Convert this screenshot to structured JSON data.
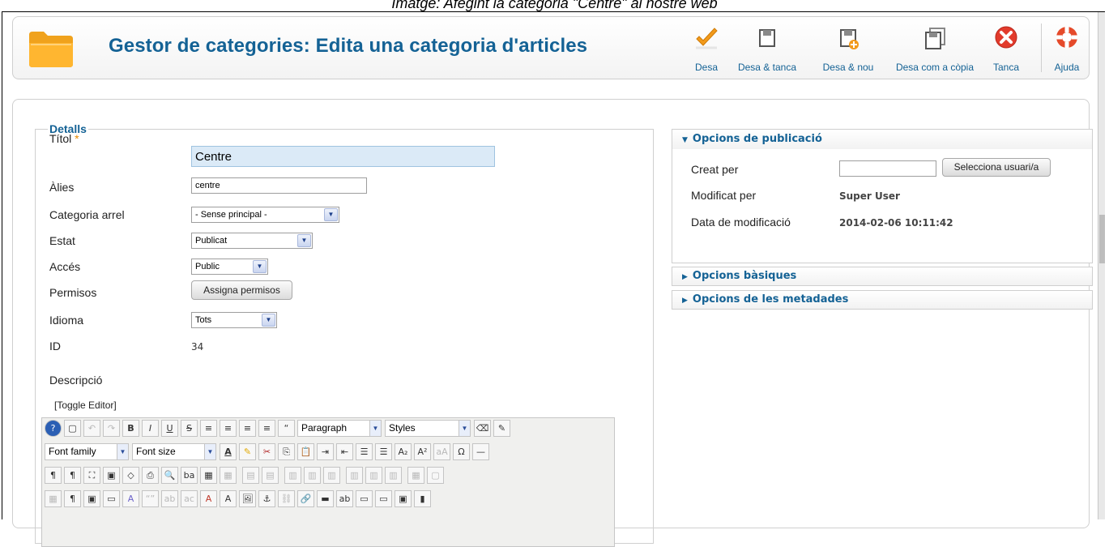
{
  "caption": "Imatge: Afegint la categoria \"Centre\" al nostre web",
  "header": {
    "title": "Gestor de categories: Edita una categoria d'articles",
    "buttons": [
      {
        "label": "Desa",
        "icon": "check-icon"
      },
      {
        "label": "Desa & tanca",
        "icon": "save-icon"
      },
      {
        "label": "Desa & nou",
        "icon": "save-new-icon"
      },
      {
        "label": "Desa com a còpia",
        "icon": "save-copy-icon"
      },
      {
        "label": "Tanca",
        "icon": "close-icon"
      },
      {
        "label": "Ajuda",
        "icon": "help-lifebuoy-icon"
      }
    ]
  },
  "details": {
    "legend": "Detalls",
    "title_label": "Títol",
    "required_mark": "*",
    "title_value": "Centre",
    "alias_label": "Àlies",
    "alias_value": "centre",
    "parent_label": "Categoria arrel",
    "parent_value": "- Sense principal -",
    "status_label": "Estat",
    "status_value": "Publicat",
    "access_label": "Accés",
    "access_value": "Public",
    "permissions_label": "Permisos",
    "permissions_button": "Assigna permisos",
    "language_label": "Idioma",
    "language_value": "Tots",
    "id_label": "ID",
    "id_value": "34",
    "description_label": "Descripció",
    "toggle_editor": "[Toggle Editor]"
  },
  "editor": {
    "format_select": "Paragraph",
    "styles_select": "Styles",
    "font_family_select": "Font family",
    "font_size_select": "Font size"
  },
  "publishing": {
    "header": "Opcions de publicació",
    "created_by_label": "Creat per",
    "created_by_value": "",
    "select_user_button": "Selecciona usuari/a",
    "modified_by_label": "Modificat per",
    "modified_by_value": "Super User",
    "modified_date_label": "Data de modificació",
    "modified_date_value": "2014-02-06 10:11:42"
  },
  "basic_options": {
    "header": "Opcions bàsiques"
  },
  "metadata_options": {
    "header": "Opcions de les metadades"
  },
  "colors": {
    "accent": "#146295",
    "required": "#e68a00",
    "title_field_bg": "#dbeaf7"
  }
}
